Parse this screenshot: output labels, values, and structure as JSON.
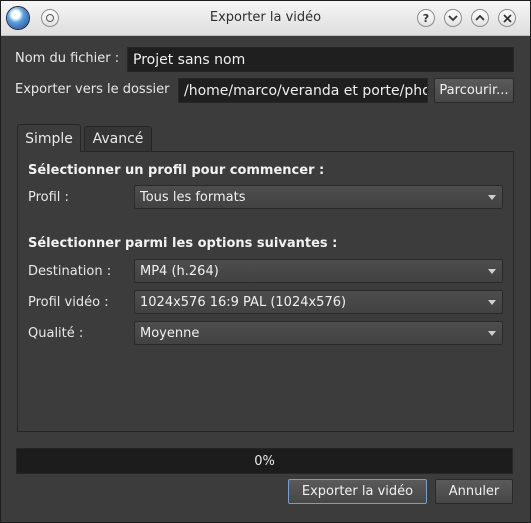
{
  "window": {
    "title": "Exporter la vidéo"
  },
  "file": {
    "name_label": "Nom du fichier :",
    "name_value": "Projet sans nom",
    "folder_label": "Exporter vers le dossier",
    "folder_value": "/home/marco/veranda et porte/photo",
    "browse_label": "Parcourir..."
  },
  "tabs": [
    {
      "label": "Simple",
      "active": true
    },
    {
      "label": "Avancé",
      "active": false
    }
  ],
  "simple": {
    "profile_heading": "Sélectionner un profil pour commencer :",
    "profile_label": "Profil :",
    "profile_value": "Tous les formats",
    "options_heading": "Sélectionner parmi les options suivantes :",
    "destination_label": "Destination :",
    "destination_value": "MP4 (h.264)",
    "video_profile_label": "Profil vidéo :",
    "video_profile_value": "1024x576 16:9 PAL (1024x576)",
    "quality_label": "Qualité :",
    "quality_value": "Moyenne"
  },
  "progress": {
    "percent": 0,
    "text": "0%"
  },
  "footer": {
    "export_label": "Exporter la vidéo",
    "cancel_label": "Annuler"
  },
  "colors": {
    "background": "#3c3c3c",
    "field": "#1f1f1f",
    "default_button_border": "#7a9ccc"
  }
}
